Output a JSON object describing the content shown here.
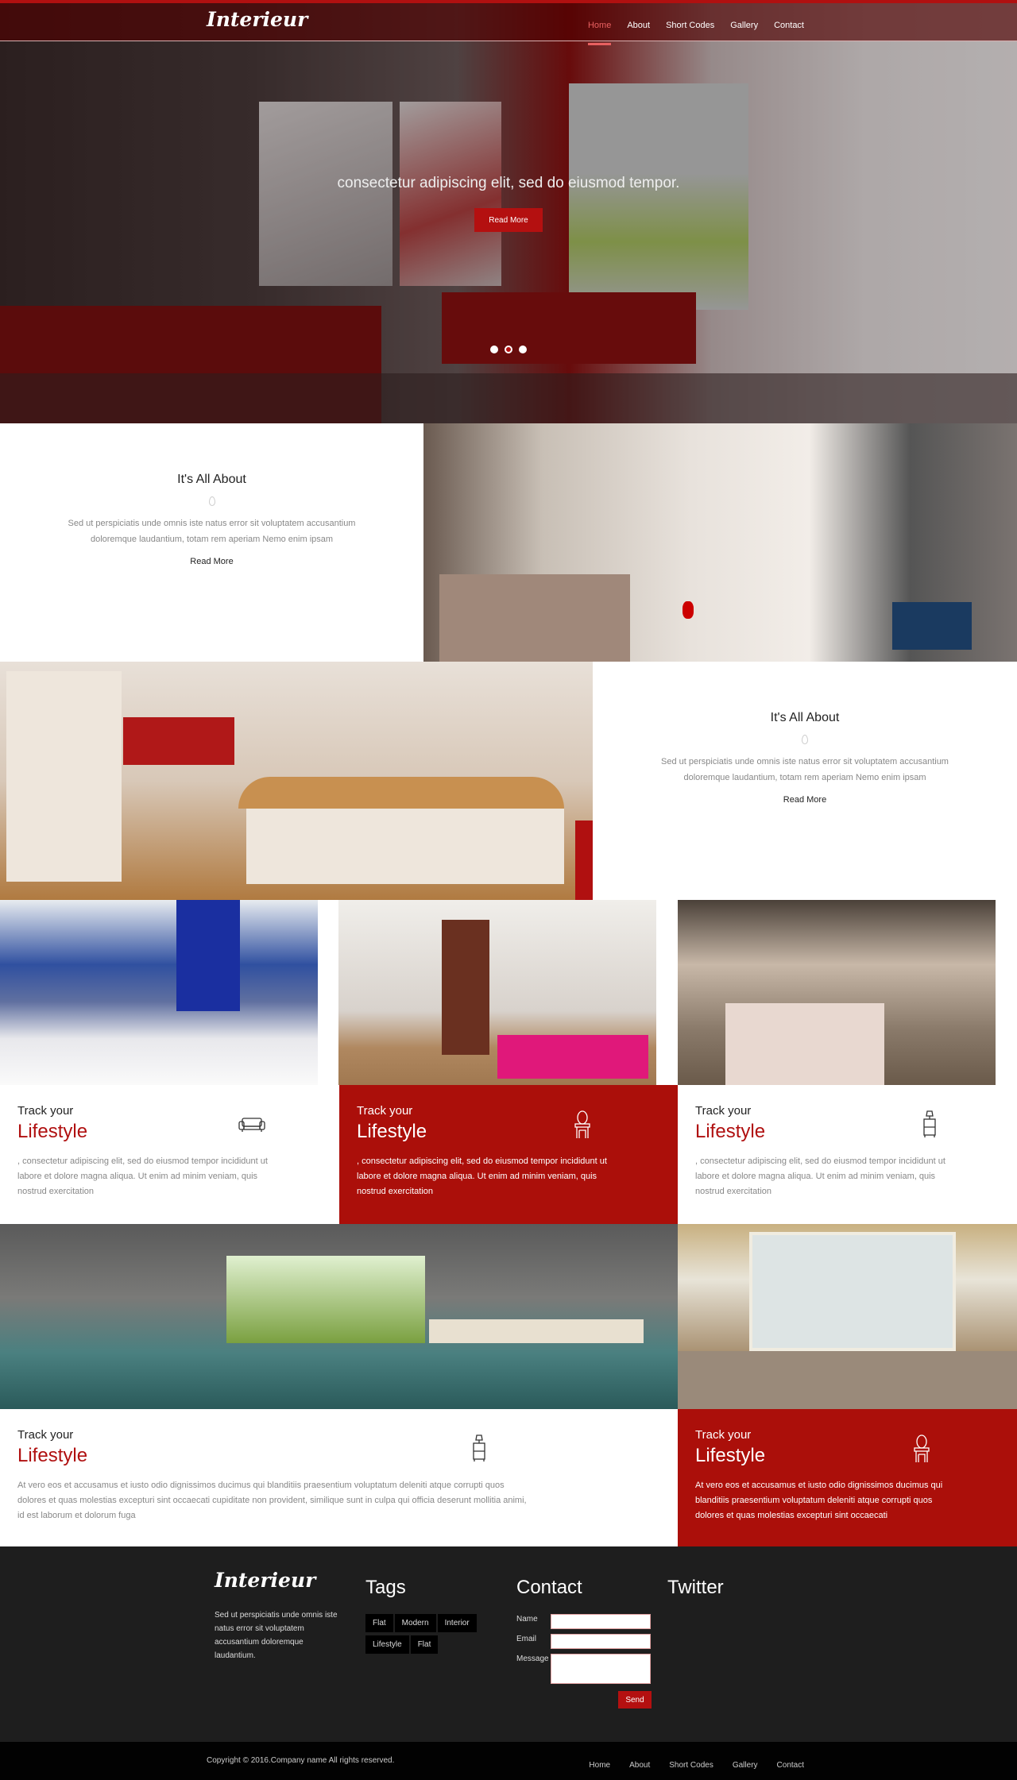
{
  "header": {
    "logo": "Interieur",
    "nav": [
      "Home",
      "About",
      "Short Codes",
      "Gallery",
      "Contact"
    ],
    "active": "Home"
  },
  "hero": {
    "caption": "consectetur adipiscing elit, sed do eiusmod tempor.",
    "button": "Read More",
    "slides": 3,
    "active_slide": 2
  },
  "about": [
    {
      "title": "It's All About",
      "text": "Sed ut perspiciatis unde omnis iste natus error sit voluptatem accusantium doloremque laudantium, totam rem aperiam Nemo enim ipsam",
      "link": "Read More"
    },
    {
      "title": "It's All About",
      "text": "Sed ut perspiciatis unde omnis iste natus error sit voluptatem accusantium doloremque laudantium, totam rem aperiam Nemo enim ipsam",
      "link": "Read More"
    }
  ],
  "cards": [
    {
      "kicker": "Track your",
      "title": "Lifestyle",
      "text": ", consectetur adipiscing elit, sed do eiusmod tempor incididunt ut labore et dolore magna aliqua. Ut enim ad minim veniam, quis nostrud exercitation",
      "icon": "sofa-icon"
    },
    {
      "kicker": "Track your",
      "title": "Lifestyle",
      "text": ", consectetur adipiscing elit, sed do eiusmod tempor incididunt ut labore et dolore magna aliqua. Ut enim ad minim veniam, quis nostrud exercitation",
      "icon": "vanity-mirror-icon"
    },
    {
      "kicker": "Track your",
      "title": "Lifestyle",
      "text": ", consectetur adipiscing elit, sed do eiusmod tempor incididunt ut labore et dolore magna aliqua. Ut enim ad minim veniam, quis nostrud exercitation",
      "icon": "lamp-nightstand-icon"
    },
    {
      "kicker": "Track your",
      "title": "Lifestyle",
      "text": "At vero eos et accusamus et iusto odio dignissimos ducimus qui blanditiis praesentium voluptatum deleniti atque corrupti quos dolores et quas molestias excepturi sint occaecati cupiditate non provident, similique sunt in culpa qui officia deserunt mollitia animi, id est laborum et dolorum fuga",
      "icon": "lamp-nightstand-icon"
    },
    {
      "kicker": "Track your",
      "title": "Lifestyle",
      "text": "At vero eos et accusamus et iusto odio dignissimos ducimus qui blanditiis praesentium voluptatum deleniti atque corrupti quos dolores et quas molestias excepturi sint occaecati",
      "icon": "vanity-mirror-icon"
    }
  ],
  "footer": {
    "logo": "Interieur",
    "about": "Sed ut perspiciatis unde omnis iste natus error sit voluptatem accusantium doloremque laudantium.",
    "tags_title": "Tags",
    "tags": [
      "Flat",
      "Modern",
      "Interior",
      "Lifestyle",
      "Flat"
    ],
    "contact_title": "Contact",
    "name_label": "Name",
    "email_label": "Email",
    "message_label": "Message",
    "send": "Send",
    "twitter_title": "Twitter",
    "copyright": "Copyright © 2016.Company name All rights reserved.",
    "nav": [
      "Home",
      "About",
      "Short Codes",
      "Gallery",
      "Contact"
    ]
  },
  "colors": {
    "accent": "#b41010",
    "footer_bg": "#1e1e1e",
    "bottom_bg": "#020202"
  }
}
